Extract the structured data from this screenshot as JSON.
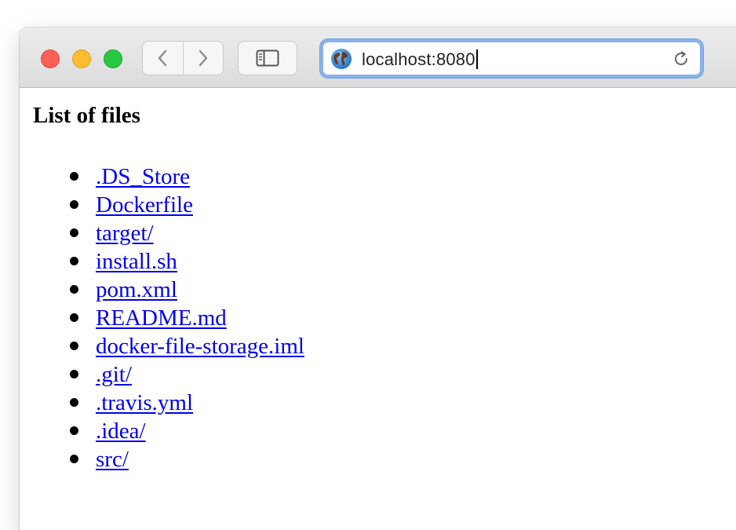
{
  "browser": {
    "address_bar": {
      "url": "localhost:8080",
      "site_icon": "globe-icon",
      "reload_icon": "reload-icon"
    },
    "toolbar": {
      "back_icon": "chevron-left-icon",
      "forward_icon": "chevron-right-icon",
      "sidebar_icon": "sidebar-icon"
    },
    "traffic_lights": {
      "close": "#fe5f57",
      "minimize": "#febc2e",
      "zoom": "#28c840"
    }
  },
  "page": {
    "heading": "List of files",
    "files": [
      ".DS_Store",
      "Dockerfile",
      "target/",
      "install.sh",
      "pom.xml",
      "README.md",
      "docker-file-storage.iml",
      ".git/",
      ".travis.yml",
      ".idea/",
      "src/"
    ],
    "link_color": "#0000ee"
  }
}
